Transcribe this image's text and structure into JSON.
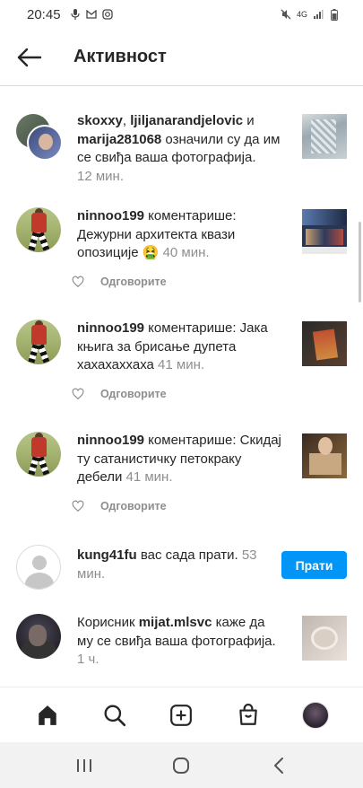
{
  "status_bar": {
    "time": "20:45",
    "network": "4G"
  },
  "header": {
    "title": "Активност",
    "back_icon": "arrow-left-icon"
  },
  "notifications": [
    {
      "type": "like",
      "user1": "skoxxy",
      "sep1": ", ",
      "user2": "ljiljanarandjelovic",
      "sep2": " и ",
      "user3": "marija281068",
      "message": " означили су да им се свиђа ваша фотографија.",
      "time": "12 мин."
    },
    {
      "type": "comment",
      "user": "ninnoo199",
      "message": " коментарише: Дежурни архитекта квази опозиције ",
      "emoji": "🤮",
      "time": "40 мин.",
      "reply_label": "Одговорите"
    },
    {
      "type": "comment",
      "user": "ninnoo199",
      "message": " коментарише: Јака књига за брисање дупета хахахаххаха",
      "time": "41 мин.",
      "reply_label": "Одговорите"
    },
    {
      "type": "comment",
      "user": "ninnoo199",
      "message": " коментарише: Скидај ту сатанистичку петокраку дебели",
      "time": "41 мин.",
      "reply_label": "Одговорите"
    },
    {
      "type": "follow",
      "user": "kung41fu",
      "message": " вас сада прати.",
      "time": "53 мин.",
      "button_label": "Прати"
    },
    {
      "type": "like",
      "prefix": "Корисник ",
      "user": "mijat.mlsvc",
      "message": " каже да му се свиђа ваша фотографија.",
      "time": "1 ч."
    }
  ],
  "bottom_nav": [
    "home-icon",
    "search-icon",
    "add-post-icon",
    "shop-icon",
    "profile-avatar"
  ],
  "colors": {
    "accent": "#0095f6",
    "text": "#262626",
    "muted": "#8e8e8e"
  }
}
